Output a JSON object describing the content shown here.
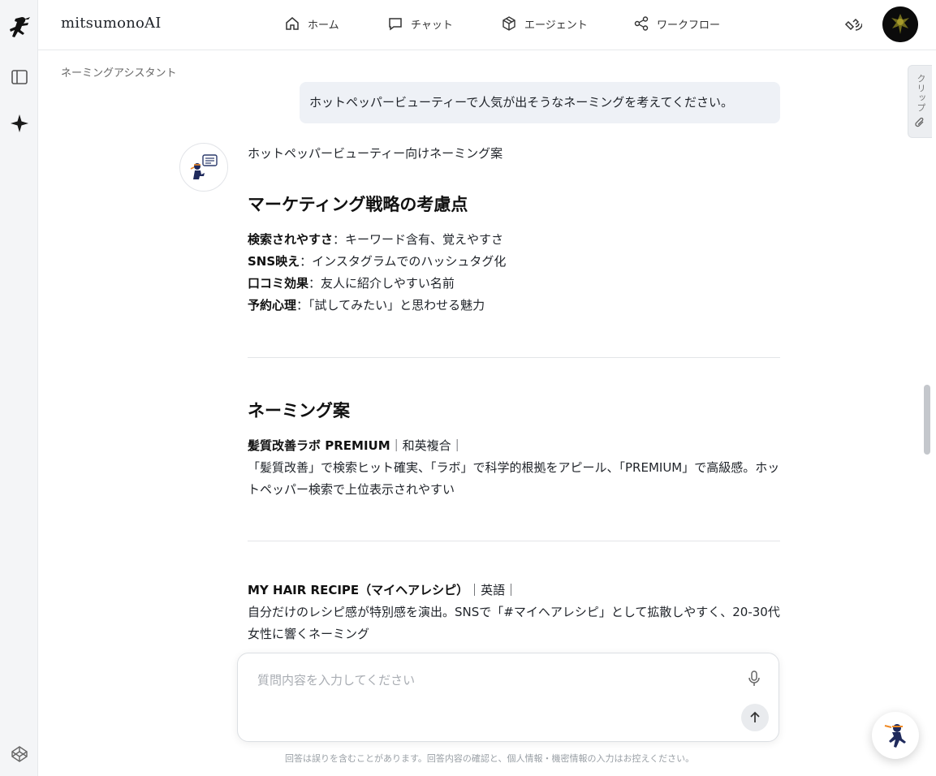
{
  "app": {
    "brand": "mitsumonoAI"
  },
  "nav": [
    {
      "label": "ホーム",
      "icon": "home-icon"
    },
    {
      "label": "チャット",
      "icon": "chat-icon"
    },
    {
      "label": "エージェント",
      "icon": "cube-icon"
    },
    {
      "label": "ワークフロー",
      "icon": "share-icon"
    }
  ],
  "breadcrumb": "ネーミングアシスタント",
  "clip_tab": "クリップ",
  "user_message": "ホットペッパービューティーで人気が出そうなネーミングを考えてください。",
  "answer": {
    "intro": "ホットペッパービューティー向けネーミング案",
    "section1_title": "マーケティング戦略の考慮点",
    "points": [
      {
        "term": "検索されやすさ",
        "desc": "：キーワード含有、覚えやすさ"
      },
      {
        "term": "SNS映え",
        "desc": "：インスタグラムでのハッシュタグ化"
      },
      {
        "term": "口コミ効果",
        "desc": "：友人に紹介しやすい名前"
      },
      {
        "term": "予約心理",
        "desc": "：「試してみたい」と思わせる魅力"
      }
    ],
    "section2_title": "ネーミング案",
    "ideas": [
      {
        "name": "髪質改善ラボ PREMIUM",
        "tag": "｜和英複合｜",
        "desc": "「髪質改善」で検索ヒット確実、「ラボ」で科学的根拠をアピール、「PREMIUM」で高級感。ホットペッパー検索で上位表示されやすい"
      },
      {
        "name": "MY HAIR RECIPE（マイヘアレシピ）",
        "tag": "｜英語｜",
        "desc": "自分だけのレシピ感が特別感を演出。SNSで「#マイヘアレシピ」として拡散しやすく、20-30代女性に響くネーミング"
      }
    ]
  },
  "composer": {
    "placeholder": "質問内容を入力してください"
  },
  "disclaimer": "回答は誤りを含むことがあります。回答内容の確認と、個人情報・機密情報の入力はお控えください。",
  "colors": {
    "user_bubble": "#eef1f6",
    "accent": "#1f2a5c",
    "ninja_orange": "#f08a24"
  }
}
